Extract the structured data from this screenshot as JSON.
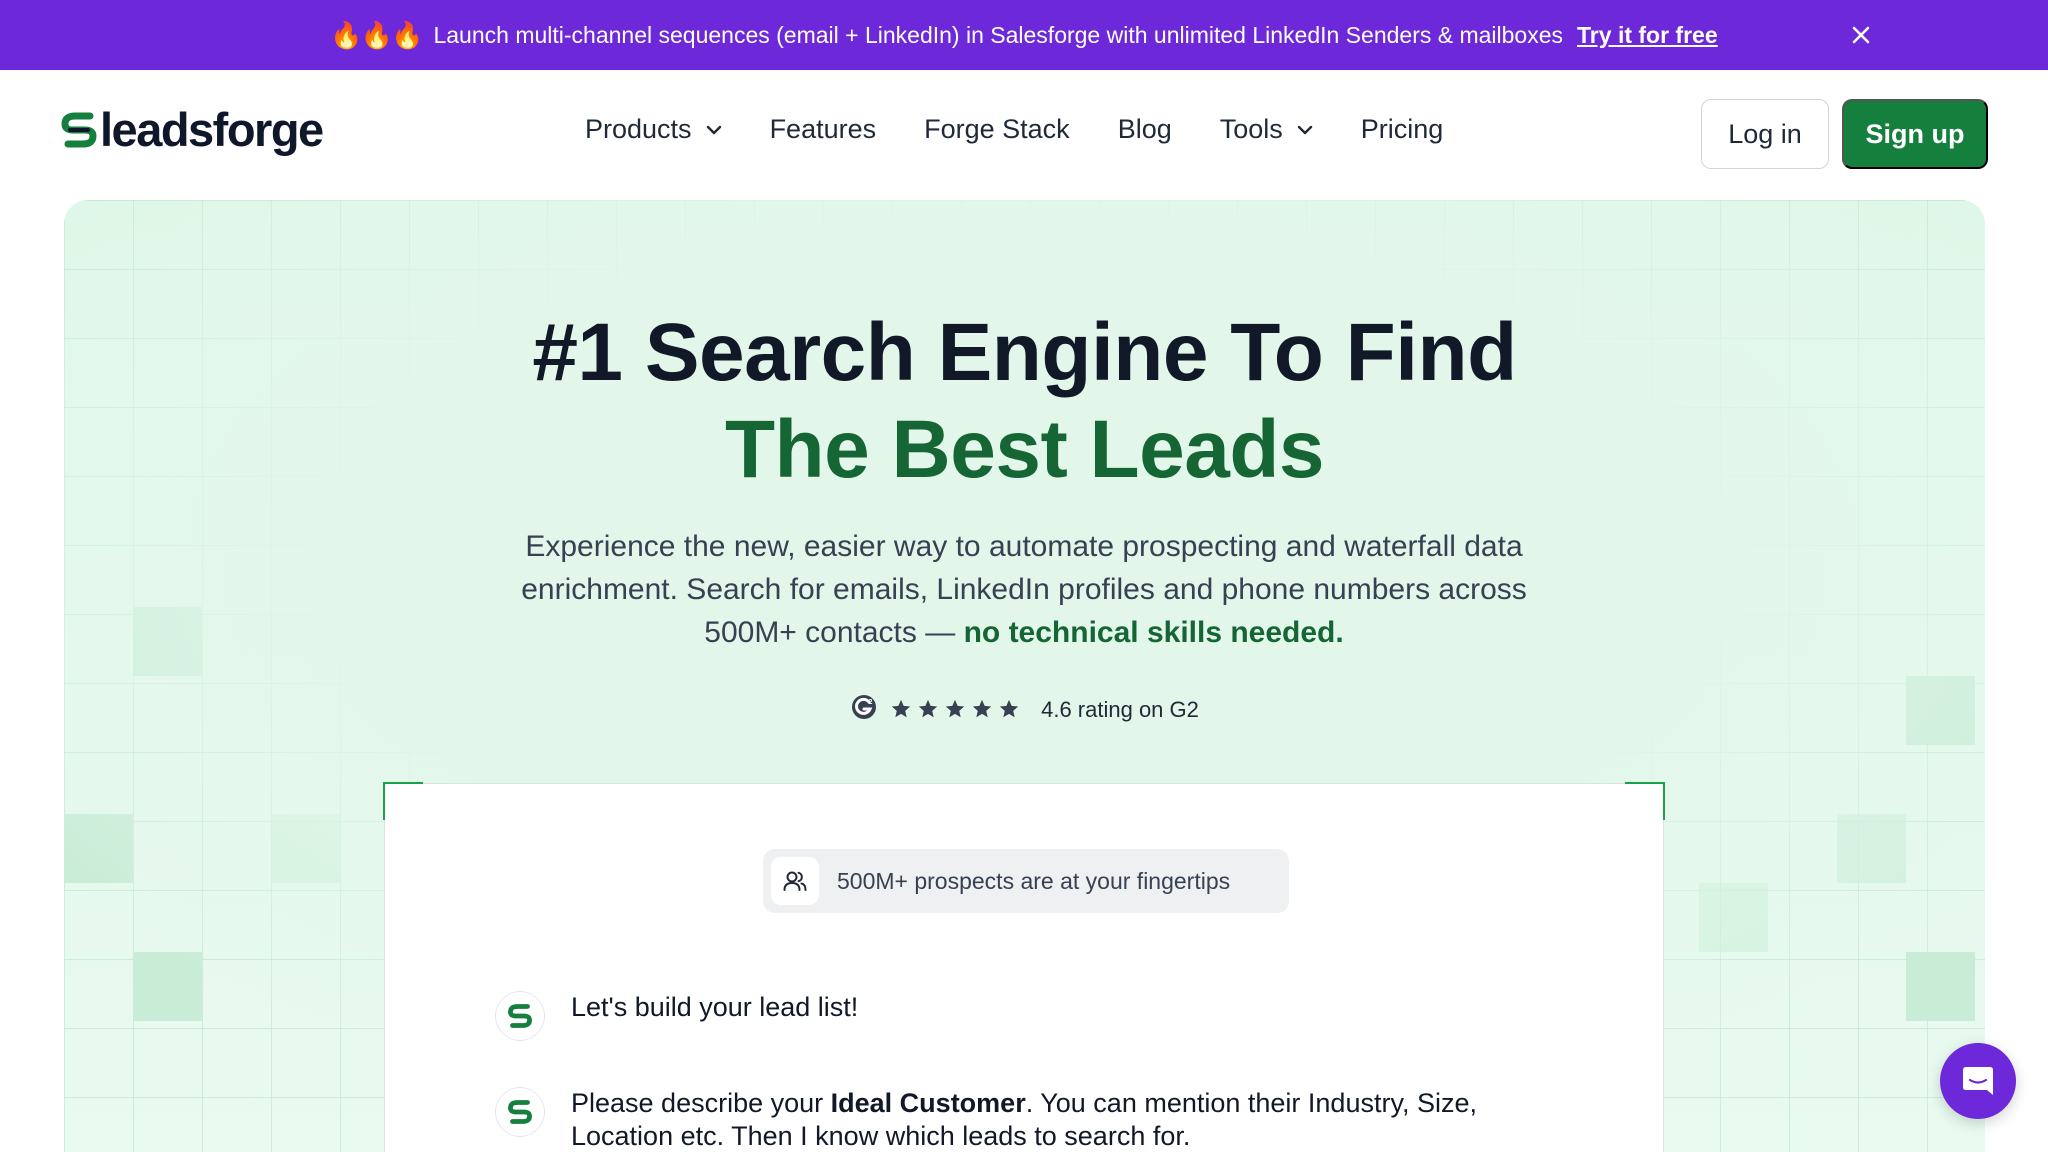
{
  "banner": {
    "flames": "🔥🔥🔥",
    "text": "Launch multi-channel sequences (email + LinkedIn) in Salesforge with unlimited LinkedIn Senders & mailboxes",
    "cta": "Try it for free",
    "close_icon": "close-icon",
    "bg_color": "#6d28d9"
  },
  "header": {
    "logo_text": "leadsforge",
    "nav": [
      {
        "label": "Products",
        "dropdown": true
      },
      {
        "label": "Features",
        "dropdown": false
      },
      {
        "label": "Forge Stack",
        "dropdown": false
      },
      {
        "label": "Blog",
        "dropdown": false
      },
      {
        "label": "Tools",
        "dropdown": true
      },
      {
        "label": "Pricing",
        "dropdown": false
      }
    ],
    "login_label": "Log in",
    "signup_label": "Sign up",
    "accent_color": "#15803d"
  },
  "hero": {
    "title_line1": "#1 Search Engine To Find",
    "title_line2": "The Best Leads",
    "subtitle_main": "Experience the new, easier way to automate prospecting and waterfall data enrichment. Search for emails, LinkedIn profiles and phone numbers across 500M+ contacts —",
    "subtitle_emphasis": "no technical skills needed.",
    "rating": {
      "stars": 5,
      "text": "4.6 rating on G2",
      "icon": "g2-logo-icon"
    }
  },
  "card": {
    "pill_text": "500M+ prospects are at your fingertips",
    "pill_icon": "users-icon",
    "messages": [
      {
        "pre": "Let's build your lead list!",
        "bold": "",
        "post": ""
      },
      {
        "pre": "Please describe your",
        "bold": "Ideal Customer",
        "post": ". You can mention their Industry, Size, Location etc. Then I know which leads to search for."
      }
    ]
  },
  "chat_widget": {
    "icon": "chat-bubble-icon",
    "color": "#6d28d9"
  }
}
